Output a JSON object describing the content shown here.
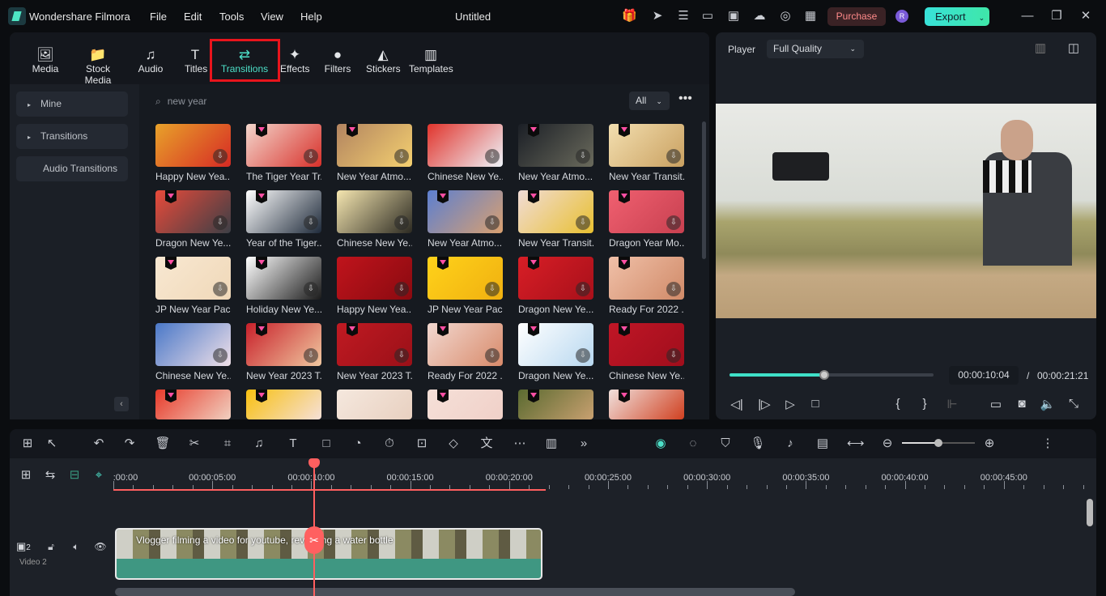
{
  "app": {
    "name": "Wondershare Filmora",
    "title": "Untitled",
    "menu": [
      "File",
      "Edit",
      "Tools",
      "View",
      "Help"
    ],
    "purchase": "Purchase",
    "avatar": "R",
    "export": "Export",
    "accent": "#4de0c8"
  },
  "tabs": [
    {
      "label": "Media",
      "icon": "🖼"
    },
    {
      "label": "Stock Media",
      "icon": "📁"
    },
    {
      "label": "Audio",
      "icon": "♫"
    },
    {
      "label": "Titles",
      "icon": "T"
    },
    {
      "label": "Transitions",
      "icon": "⇄",
      "active": true
    },
    {
      "label": "Effects",
      "icon": "✦"
    },
    {
      "label": "Filters",
      "icon": "●"
    },
    {
      "label": "Stickers",
      "icon": "◭"
    },
    {
      "label": "Templates",
      "icon": "▥"
    }
  ],
  "sidebar": [
    "Mine",
    "Transitions",
    "Audio Transitions"
  ],
  "search": {
    "value": "new year",
    "filter": "All"
  },
  "items": [
    {
      "label": "Happy New Yea...",
      "c": [
        "#e8a22a",
        "#d62a24"
      ],
      "gem": false
    },
    {
      "label": "The Tiger Year Tr...",
      "c": [
        "#f3d6cc",
        "#d8302a"
      ],
      "gem": true
    },
    {
      "label": "New Year Atmo...",
      "c": [
        "#b28460",
        "#f4d070"
      ],
      "gem": true
    },
    {
      "label": "Chinese New Ye...",
      "c": [
        "#e1342c",
        "#eef4fa"
      ],
      "gem": false
    },
    {
      "label": "New Year Atmo...",
      "c": [
        "#1b1f26",
        "#6a6a5c"
      ],
      "gem": true
    },
    {
      "label": "New Year Transit...",
      "c": [
        "#f3dfb0",
        "#c9a060"
      ],
      "gem": true
    },
    {
      "label": "Dragon New Ye...",
      "c": [
        "#e84a3a",
        "#3c3f46"
      ],
      "gem": true
    },
    {
      "label": "Year of the Tiger...",
      "c": [
        "#ffffff",
        "#1e2a3a"
      ],
      "gem": true
    },
    {
      "label": "Chinese New Ye...",
      "c": [
        "#f5e6b0",
        "#2c2a22"
      ],
      "gem": false
    },
    {
      "label": "New Year Atmo...",
      "c": [
        "#5c7fd0",
        "#d9a070"
      ],
      "gem": true
    },
    {
      "label": "New Year Transit...",
      "c": [
        "#f1dcd6",
        "#e8c030"
      ],
      "gem": true
    },
    {
      "label": "Dragon Year Mo...",
      "c": [
        "#f06070",
        "#c84050"
      ],
      "gem": true
    },
    {
      "label": "JP New Year Pac...",
      "c": [
        "#f8e8d2",
        "#f0d8b8"
      ],
      "gem": true
    },
    {
      "label": "Holiday New Ye...",
      "c": [
        "#ffffff",
        "#1a1a1a"
      ],
      "gem": true
    },
    {
      "label": "Happy New Yea...",
      "c": [
        "#c0141c",
        "#8a0a10"
      ],
      "gem": false
    },
    {
      "label": "JP New Year Pac...",
      "c": [
        "#ffd21a",
        "#f0b010"
      ],
      "gem": true
    },
    {
      "label": "Dragon New Ye...",
      "c": [
        "#d81e26",
        "#a8101a"
      ],
      "gem": true
    },
    {
      "label": "Ready For 2022 ...",
      "c": [
        "#f0c0a8",
        "#d08a68"
      ],
      "gem": true
    },
    {
      "label": "Chinese New Ye...",
      "c": [
        "#4a78c8",
        "#f0e0e8"
      ],
      "gem": false
    },
    {
      "label": "New Year 2023 T...",
      "c": [
        "#c8202a",
        "#f0c8a0"
      ],
      "gem": true
    },
    {
      "label": "New Year 2023 T...",
      "c": [
        "#c01a22",
        "#9a1018"
      ],
      "gem": true
    },
    {
      "label": "Ready For 2022 ...",
      "c": [
        "#f2d8d0",
        "#d88a6a"
      ],
      "gem": true
    },
    {
      "label": "Dragon New Ye...",
      "c": [
        "#ffffff",
        "#b8d8f0"
      ],
      "gem": true
    },
    {
      "label": "Chinese New Ye...",
      "c": [
        "#c01626",
        "#a00e1c"
      ],
      "gem": true
    },
    {
      "label": "",
      "c": [
        "#e83a2a",
        "#f0d0c0"
      ],
      "gem": true
    },
    {
      "label": "",
      "c": [
        "#f8c010",
        "#f5e0d8"
      ],
      "gem": true
    },
    {
      "label": "",
      "c": [
        "#f5e8de",
        "#e8d0c0"
      ],
      "gem": false
    },
    {
      "label": "",
      "c": [
        "#f5e0d8",
        "#f0d0c8"
      ],
      "gem": true
    },
    {
      "label": "",
      "c": [
        "#5a6a30",
        "#c8a070"
      ],
      "gem": true
    },
    {
      "label": "",
      "c": [
        "#f0e0dc",
        "#d04020"
      ],
      "gem": true
    }
  ],
  "player": {
    "label": "Player",
    "quality": "Full Quality",
    "current": "00:00:10:04",
    "sep": "/",
    "total": "00:00:21:21",
    "progress": 0.465
  },
  "timeline": {
    "ticks": [
      ":00:00",
      "00:00:05:00",
      "00:00:10:00",
      "00:00:15:00",
      "00:00:20:00",
      "00:00:25:00",
      "00:00:30:00",
      "00:00:35:00",
      "00:00:40:00",
      "00:00:45:00"
    ],
    "track": "Video 2",
    "track_num": "2",
    "clip": "Vlogger filming a video for youtube, reviewing a water bottle",
    "zoom": 0.5
  }
}
